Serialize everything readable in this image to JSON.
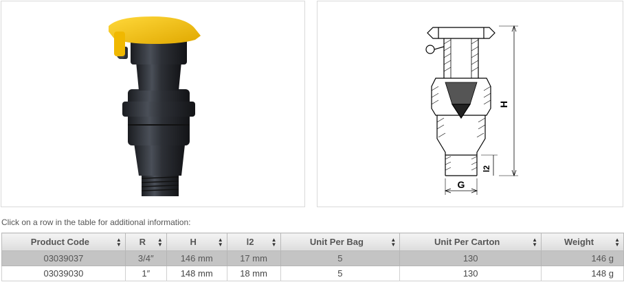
{
  "hint": "Click on a row in the table for additional information:",
  "drawing_labels": {
    "height": "H",
    "thread": "G",
    "length": "l2"
  },
  "table": {
    "headers": [
      "Product Code",
      "R",
      "H",
      "l2",
      "Unit Per Bag",
      "Unit Per Carton",
      "Weight"
    ],
    "rows": [
      [
        "03039037",
        "3/4″",
        "146 mm",
        "17 mm",
        "5",
        "130",
        "146 g"
      ],
      [
        "03039030",
        "1″",
        "148 mm",
        "18 mm",
        "5",
        "130",
        "148 g"
      ]
    ]
  },
  "colors": {
    "cap": "#f5c400",
    "body": "#2a2d33",
    "selected_row": "#c4c4c4",
    "header": "#e6e6e6"
  }
}
